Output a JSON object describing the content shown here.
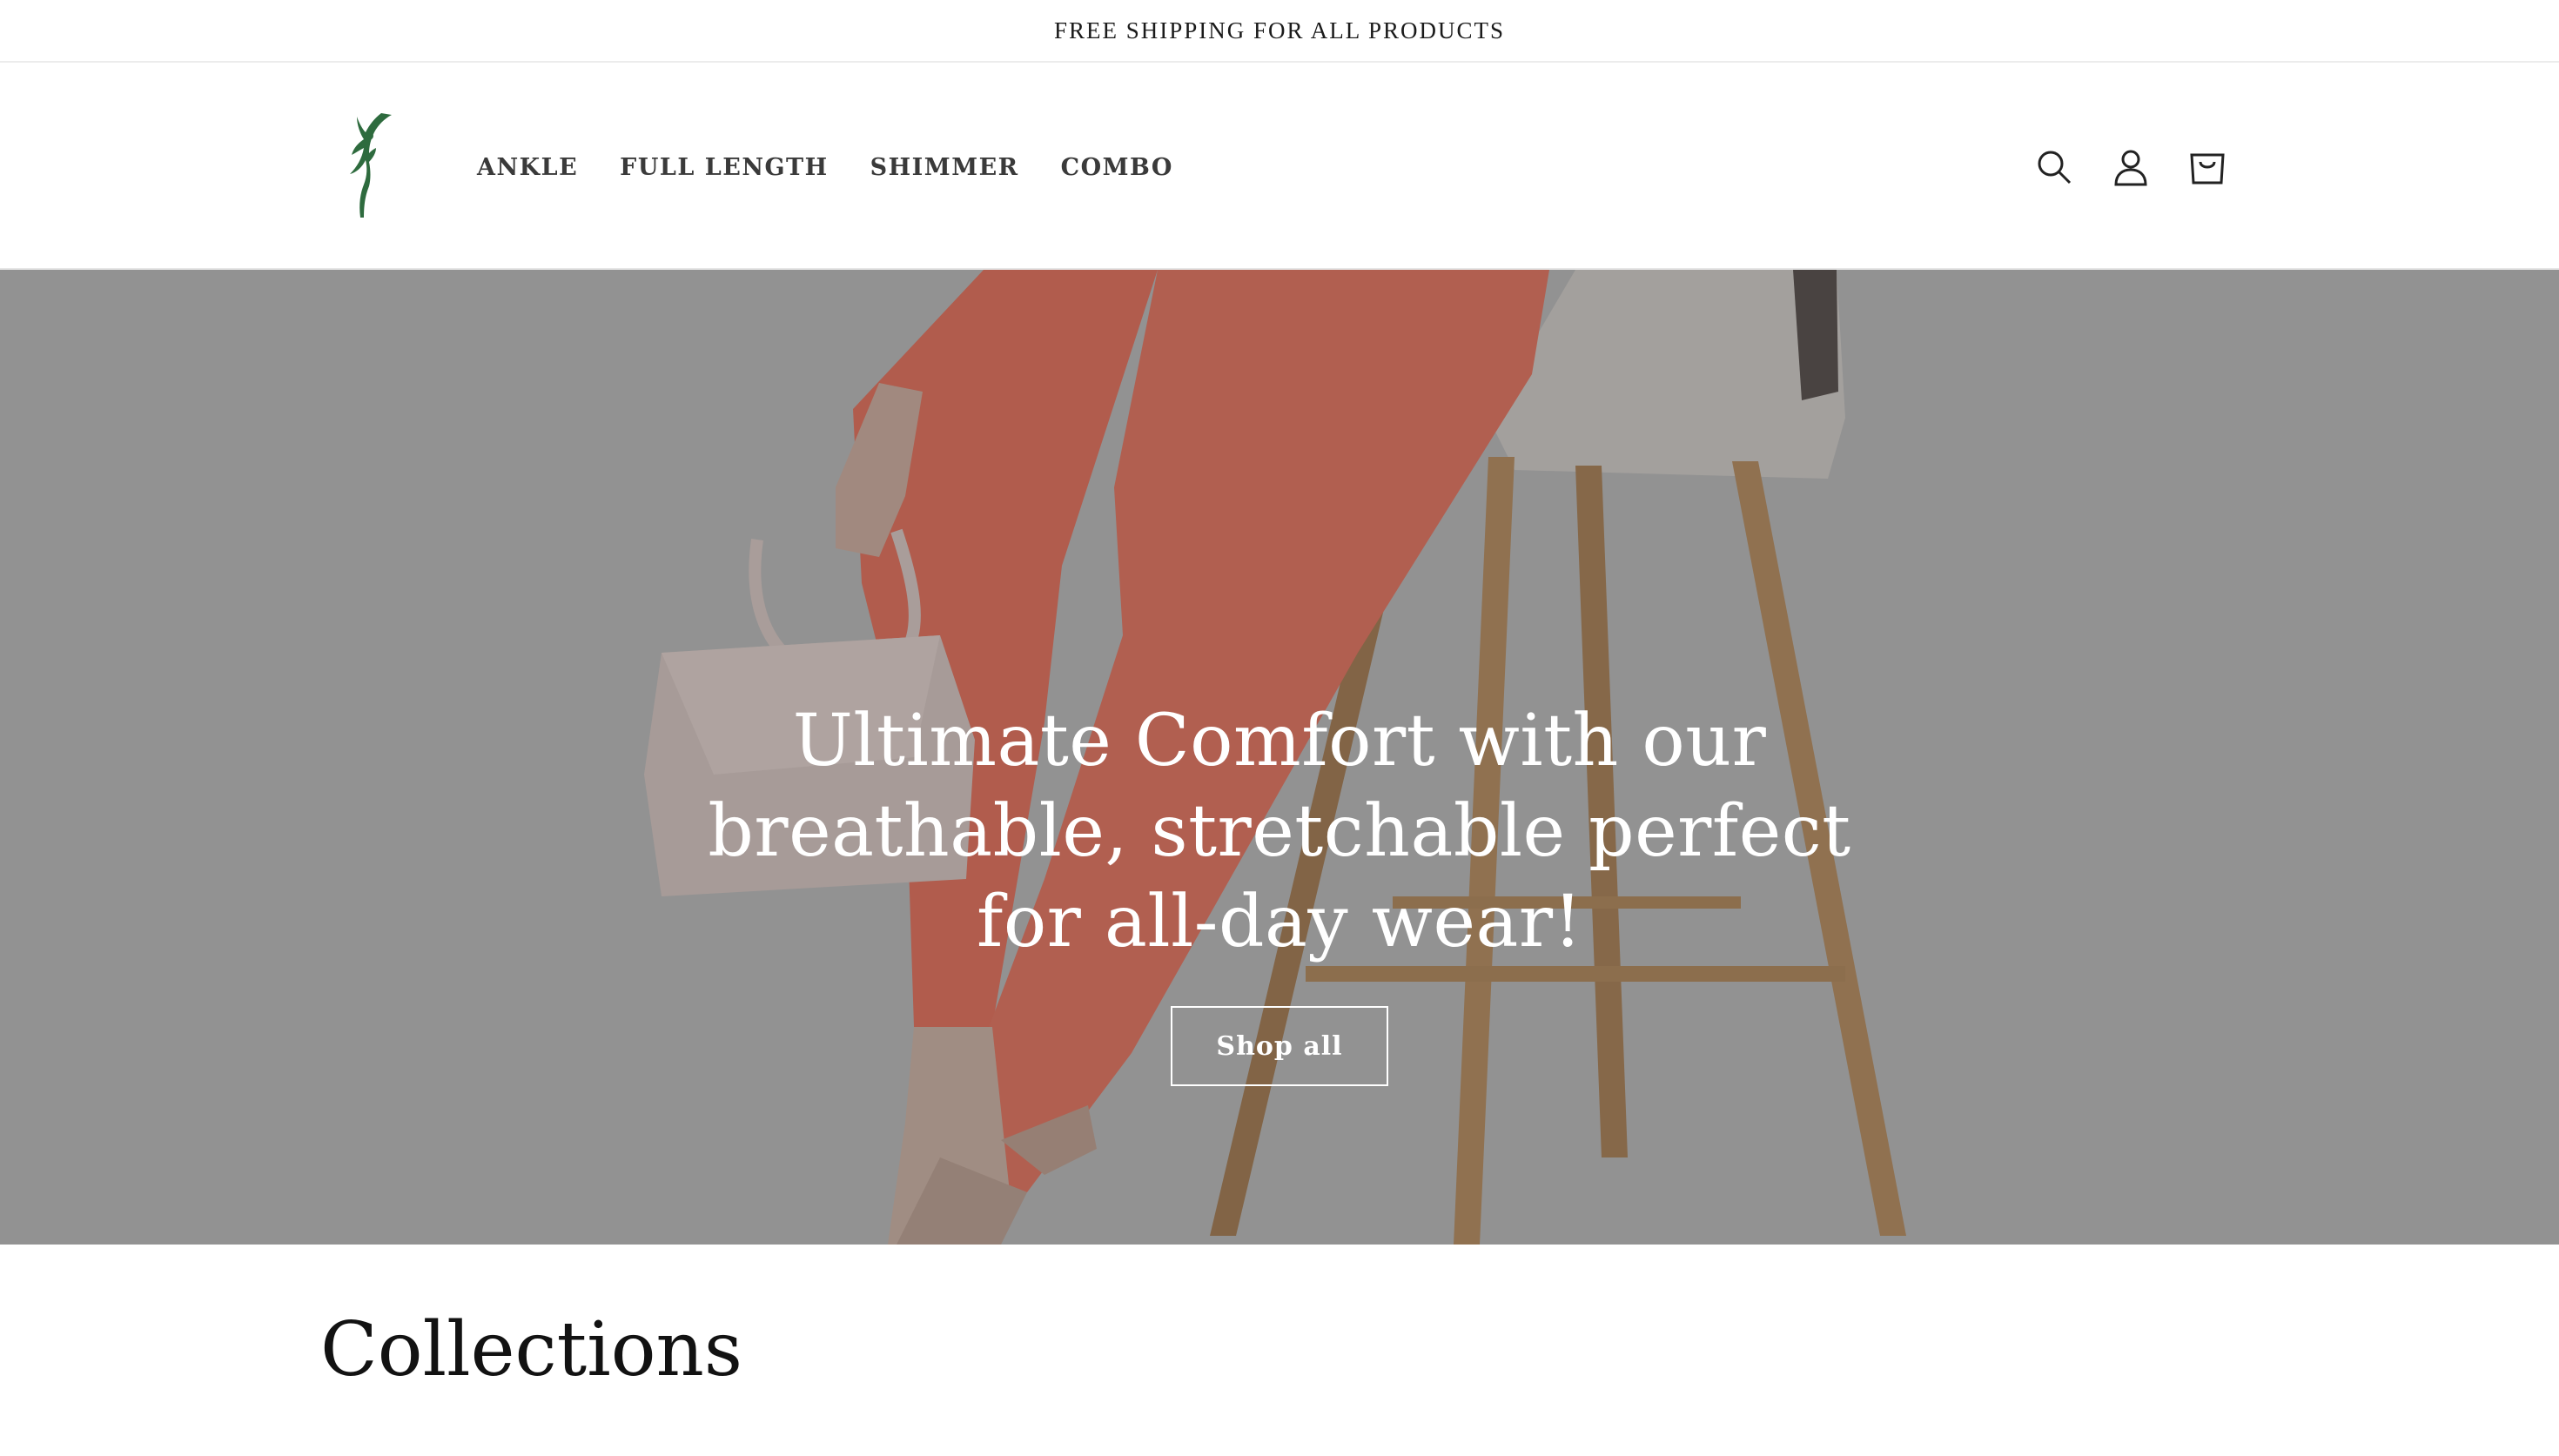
{
  "announcement": {
    "text": "FREE SHIPPING FOR ALL PRODUCTS"
  },
  "header": {
    "logo_icon": "dancer-logo-icon",
    "nav": [
      {
        "label": "ANKLE"
      },
      {
        "label": "FULL LENGTH"
      },
      {
        "label": "SHIMMER"
      },
      {
        "label": "COMBO"
      }
    ],
    "icons": [
      "search-icon",
      "account-icon",
      "cart-icon"
    ]
  },
  "hero": {
    "heading": "Ultimate Comfort with our breathable, stretchable perfect for all-day wear!",
    "button_label": "Shop all"
  },
  "collections": {
    "title": "Collections"
  },
  "colors": {
    "logo_green": "#2e6b3e",
    "legging_coral": "#e96a57",
    "hero_bg": "#9a9a9a"
  }
}
